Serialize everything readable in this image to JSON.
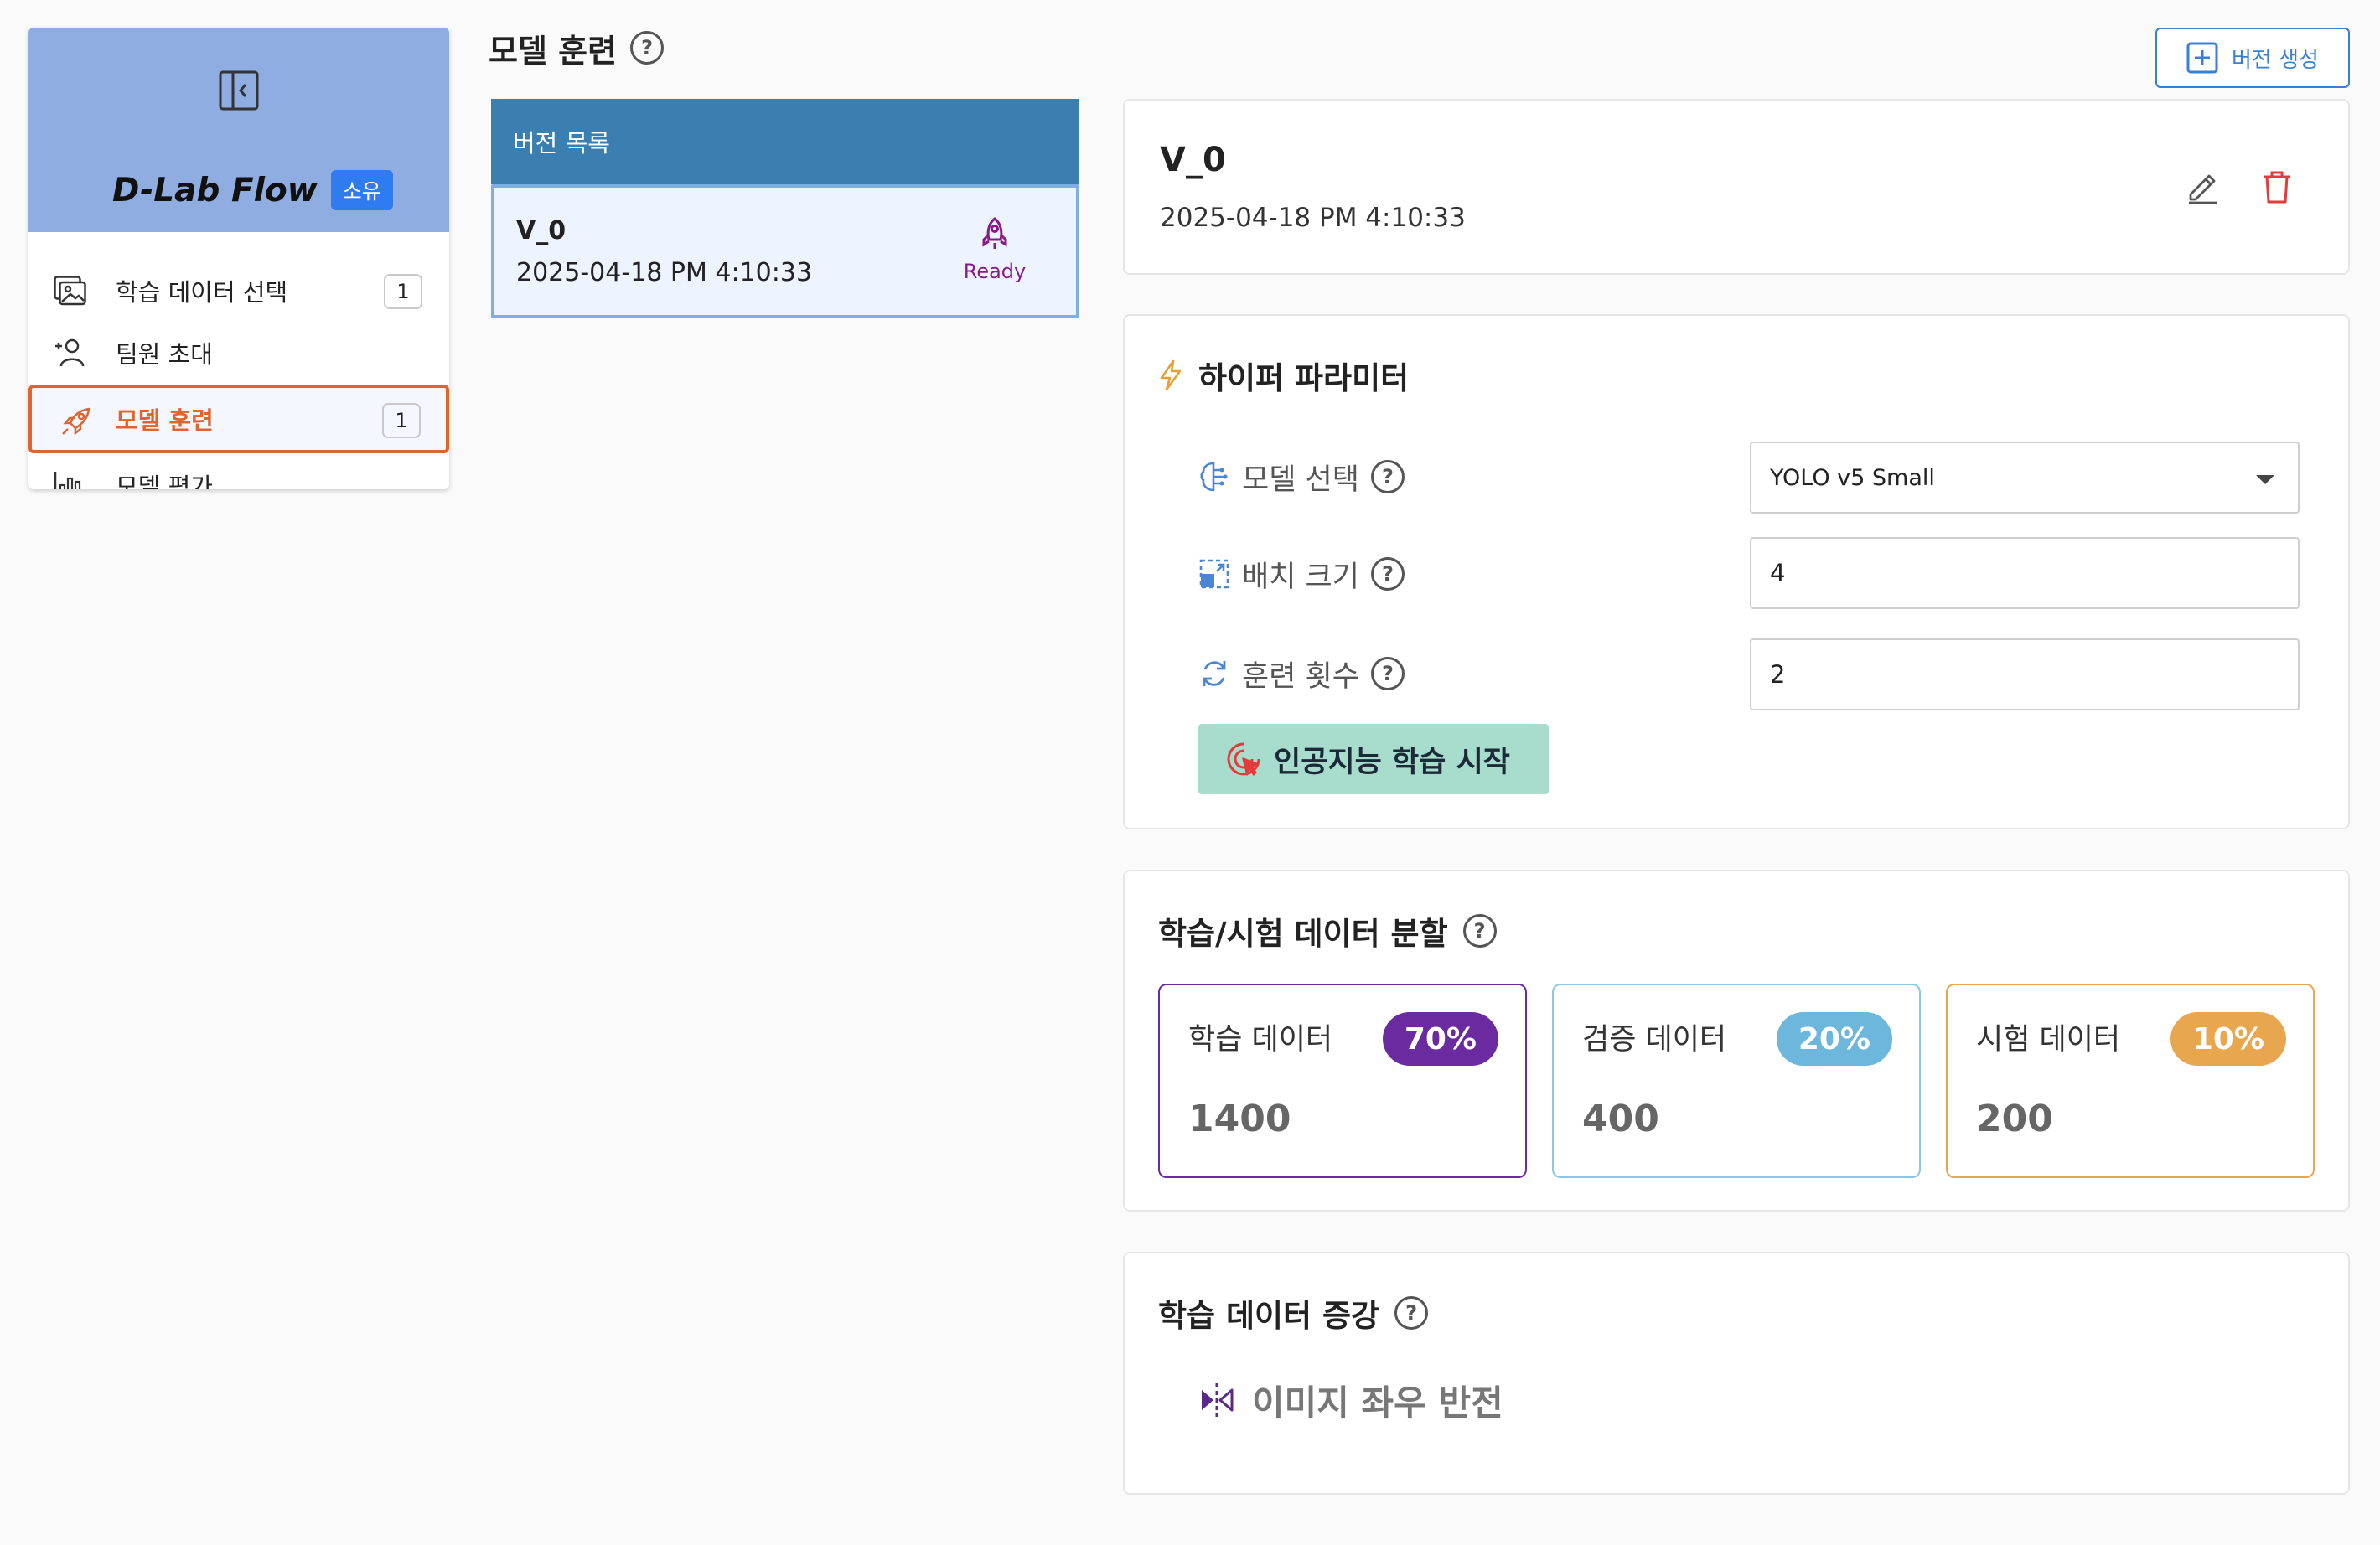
{
  "sidebar": {
    "brand": "D-Lab Flow",
    "badge": "소유",
    "items": [
      {
        "label": "학습 데이터 선택",
        "count": "1"
      },
      {
        "label": "팀원 초대"
      },
      {
        "label": "모델 훈련",
        "count": "1"
      },
      {
        "label": "모델 평가"
      }
    ]
  },
  "header": {
    "title": "모델 훈련",
    "help": "?",
    "create_button": "버전 생성"
  },
  "version_list": {
    "title": "버전 목록",
    "items": [
      {
        "name": "V_0",
        "date": "2025-04-18 PM 4:10:33",
        "status": "Ready"
      }
    ]
  },
  "version_detail": {
    "name": "V_0",
    "date": "2025-04-18 PM 4:10:33"
  },
  "hyperparams": {
    "title": "하이퍼 파라미터",
    "model_label": "모델 선택",
    "model_value": "YOLO v5 Small",
    "batch_label": "배치 크기",
    "batch_value": "4",
    "epoch_label": "훈련 횟수",
    "epoch_value": "2",
    "start_button": "인공지능 학습 시작"
  },
  "split": {
    "title": "학습/시험 데이터 분할",
    "train": {
      "label": "학습 데이터",
      "pct": "70%",
      "count": "1400",
      "color": "#6a2ba0"
    },
    "val": {
      "label": "검증 데이터",
      "pct": "20%",
      "count": "400",
      "color": "#6db6dc"
    },
    "test": {
      "label": "시험 데이터",
      "pct": "10%",
      "count": "200",
      "color": "#e8a64e"
    }
  },
  "augmentation": {
    "title": "학습 데이터 증강",
    "items": [
      {
        "label": "이미지 좌우 반전"
      }
    ]
  },
  "colors": {
    "sidebar_header": "#8fade0",
    "active_nav": "#e0642d",
    "list_header": "#3a7fb0",
    "start_button": "#a8dccc",
    "accent": "#3a7fd6"
  }
}
